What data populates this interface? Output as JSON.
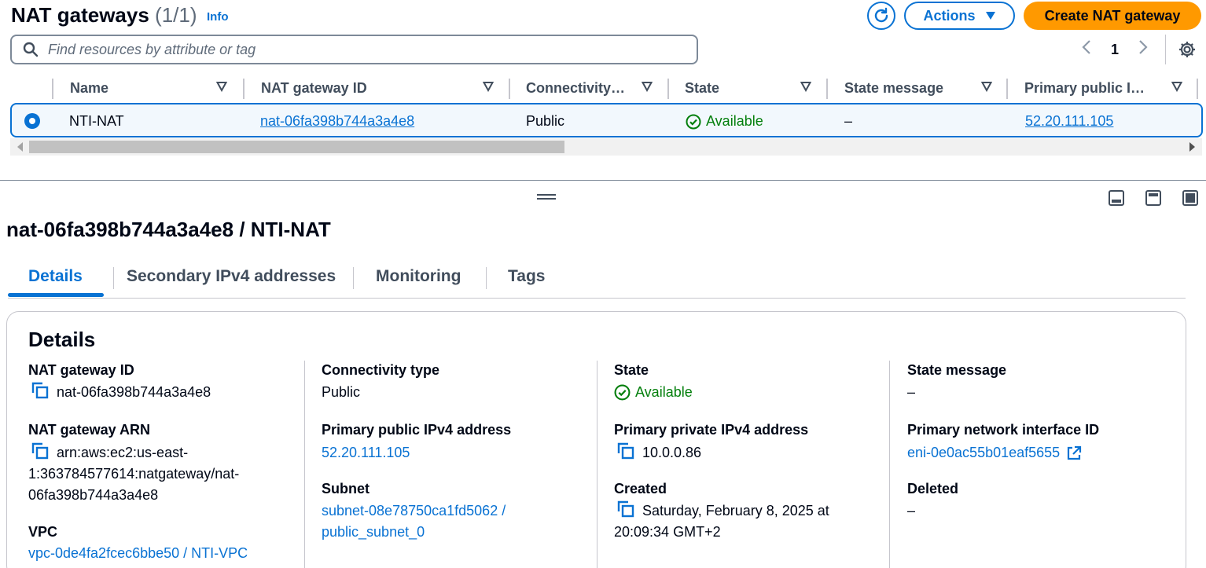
{
  "header": {
    "title": "NAT gateways",
    "count": "(1/1)",
    "info": "Info",
    "actions_label": "Actions",
    "create_label": "Create NAT gateway"
  },
  "search": {
    "placeholder": "Find resources by attribute or tag"
  },
  "pagination": {
    "current_page": "1"
  },
  "table": {
    "columns": [
      "Name",
      "NAT gateway ID",
      "Connectivity…",
      "State",
      "State message",
      "Primary public I…"
    ],
    "rows": [
      {
        "name": "NTI-NAT",
        "nat_gateway_id": "nat-06fa398b744a3a4e8",
        "connectivity": "Public",
        "state": "Available",
        "state_message": "–",
        "primary_public_ip": "52.20.111.105",
        "selected": true
      }
    ]
  },
  "detail": {
    "title": "nat-06fa398b744a3a4e8 / NTI-NAT",
    "tabs": [
      "Details",
      "Secondary IPv4 addresses",
      "Monitoring",
      "Tags"
    ],
    "active_tab": "Details",
    "card_title": "Details",
    "fields": {
      "nat_gateway_id_label": "NAT gateway ID",
      "nat_gateway_id": "nat-06fa398b744a3a4e8",
      "nat_gateway_arn_label": "NAT gateway ARN",
      "nat_gateway_arn_line1": "arn:aws:ec2:us-east-",
      "nat_gateway_arn_line2": "1:363784577614:natgateway/nat-",
      "nat_gateway_arn_line3": "06fa398b744a3a4e8",
      "vpc_label": "VPC",
      "vpc": "vpc-0de4fa2fcec6bbe50 / NTI-VPC",
      "connectivity_type_label": "Connectivity type",
      "connectivity_type": "Public",
      "primary_public_ip_label": "Primary public IPv4 address",
      "primary_public_ip": "52.20.111.105",
      "subnet_label": "Subnet",
      "subnet_line1": "subnet-08e78750ca1fd5062 /",
      "subnet_line2": "public_subnet_0",
      "state_label": "State",
      "state": "Available",
      "primary_private_ip_label": "Primary private IPv4 address",
      "primary_private_ip": "10.0.0.86",
      "created_label": "Created",
      "created_line1": "Saturday, February 8, 2025 at",
      "created_line2": "20:09:34 GMT+2",
      "state_message_label": "State message",
      "state_message": "–",
      "primary_eni_label": "Primary network interface ID",
      "primary_eni": "eni-0e0ac55b01eaf5655",
      "deleted_label": "Deleted",
      "deleted": "–"
    }
  },
  "colors": {
    "primary_blue": "#0972d3",
    "orange": "#ff9900",
    "success_green": "#037f0c",
    "text": "#000716",
    "muted": "#414d5c"
  },
  "icons": [
    "refresh-icon",
    "caret-down-icon",
    "search-icon",
    "chevron-left-icon",
    "chevron-right-icon",
    "settings-icon",
    "sort-icon",
    "status-available-icon",
    "copy-icon",
    "external-link-icon",
    "drag-handle-icon"
  ]
}
